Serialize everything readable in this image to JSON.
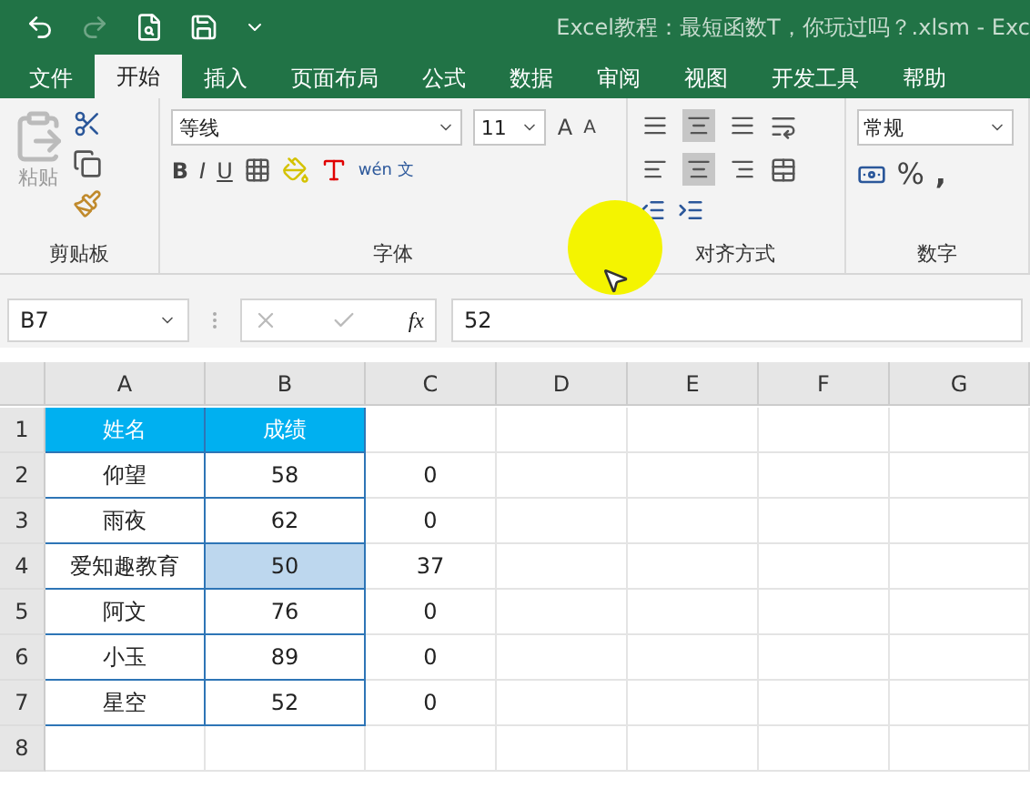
{
  "title_bar": {
    "title": "Excel教程：最短函数T，你玩过吗？.xlsm  -  Exc"
  },
  "tabs": [
    {
      "label": "文件",
      "selected": false
    },
    {
      "label": "开始",
      "selected": true
    },
    {
      "label": "插入",
      "selected": false
    },
    {
      "label": "页面布局",
      "selected": false
    },
    {
      "label": "公式",
      "selected": false
    },
    {
      "label": "数据",
      "selected": false
    },
    {
      "label": "审阅",
      "selected": false
    },
    {
      "label": "视图",
      "selected": false
    },
    {
      "label": "开发工具",
      "selected": false
    },
    {
      "label": "帮助",
      "selected": false
    }
  ],
  "ribbon": {
    "paste_label": "粘贴",
    "font_name": "等线",
    "font_size": "11",
    "bold": "B",
    "italic": "I",
    "underline": "U",
    "grow": "A",
    "shrink": "A",
    "phonetic": "wén",
    "phonetic_char": "文",
    "number_format": "常规",
    "percent": "%",
    "comma": ",",
    "groups": [
      "剪贴板",
      "字体",
      "对齐方式",
      "数字"
    ],
    "vertical_align": [
      {
        "kind": "top",
        "selected": false
      },
      {
        "kind": "middle",
        "selected": true
      },
      {
        "kind": "bottom",
        "selected": false
      }
    ],
    "horizontal_align": [
      {
        "kind": "left",
        "selected": false
      },
      {
        "kind": "center",
        "selected": true
      },
      {
        "kind": "right",
        "selected": false
      }
    ]
  },
  "formula_bar": {
    "name_box": "B7",
    "fx": "fx",
    "value": "52"
  },
  "sheet": {
    "columns": [
      "A",
      "B",
      "C",
      "D",
      "E",
      "F",
      "G"
    ],
    "rows": [
      {
        "number": "1",
        "a": "姓名",
        "b": "成绩",
        "header": true,
        "highlighted": false
      },
      {
        "number": "2",
        "a": "仰望",
        "b": "58",
        "c": "0",
        "header": false,
        "highlighted": false
      },
      {
        "number": "3",
        "a": "雨夜",
        "b": "62",
        "c": "0",
        "header": false,
        "highlighted": false
      },
      {
        "number": "4",
        "a": "爱知趣教育",
        "b": "50",
        "c": "37",
        "header": false,
        "highlighted": true
      },
      {
        "number": "5",
        "a": "阿文",
        "b": "76",
        "c": "0",
        "header": false,
        "highlighted": false
      },
      {
        "number": "6",
        "a": "小玉",
        "b": "89",
        "c": "0",
        "header": false,
        "highlighted": false
      },
      {
        "number": "7",
        "a": "星空",
        "b": "52",
        "c": "0",
        "header": false,
        "highlighted": false
      },
      {
        "number": "8",
        "header": false,
        "highlighted": false
      }
    ]
  }
}
